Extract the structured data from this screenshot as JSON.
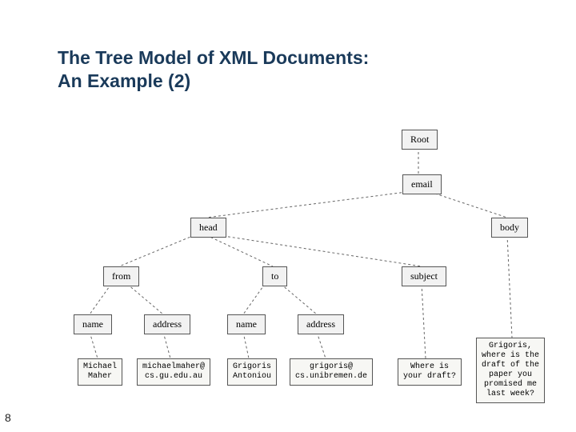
{
  "title_line1": "The Tree Model of XML Documents:",
  "title_line2": "An Example (2)",
  "page_number": "8",
  "nodes": {
    "root": "Root",
    "email": "email",
    "head": "head",
    "body": "body",
    "from": "from",
    "to": "to",
    "subject": "subject",
    "from_name": "name",
    "from_address": "address",
    "to_name": "name",
    "to_address": "address"
  },
  "leaves": {
    "from_name_val": "Michael\nMaher",
    "from_address_val": "michaelmaher@\ncs.gu.edu.au",
    "to_name_val": "Grigoris\nAntoniou",
    "to_address_val": "grigoris@\ncs.unibremen.de",
    "subject_val": "Where is\nyour draft?",
    "body_val": "Grigoris,\nwhere is the\ndraft of the\npaper you\npromised me\nlast week?"
  }
}
